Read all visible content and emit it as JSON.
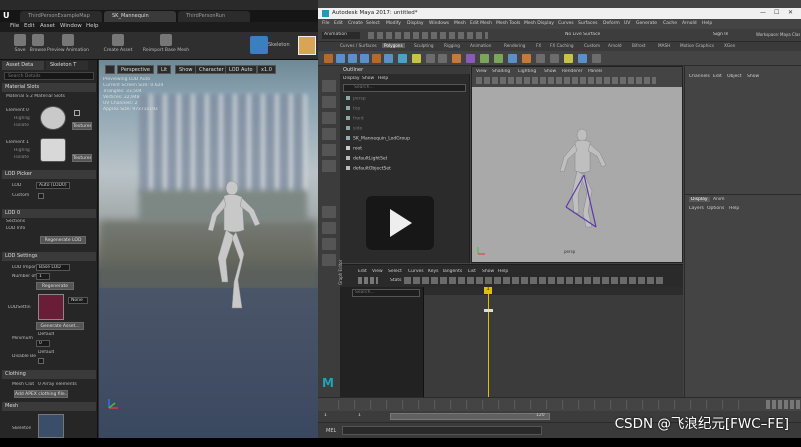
{
  "ue": {
    "tabs": [
      "ThirdPersonExampleMap",
      "SK_Mannequin",
      "ThirdPersonRun"
    ],
    "menu": [
      "File",
      "Edit",
      "Asset",
      "Window",
      "Help"
    ],
    "toolbar": [
      "Save",
      "Browse",
      "Preview Animation",
      "Create Asset",
      "Reimport Base Mesh"
    ],
    "skeleton_label": "Skeleton",
    "panel_tabs": [
      "Asset Deta",
      "Skeleton T"
    ],
    "search_placeholder": "Search Details",
    "sections": {
      "material_slots": "Material Slots",
      "lod_picker": "LOD Picker",
      "lod0": "LOD 0",
      "lod_settings": "LOD Settings",
      "clothing": "Clothing",
      "mesh": "Mesh"
    },
    "material_slots_text": "Material S  2 Material Slots",
    "element0": "Element 0",
    "element1": "Element 1",
    "highlight": "Highlig",
    "isolate": "Isolate",
    "textures": "Textures",
    "lod_label": "LOD",
    "lod_value": "Auto (LOD0)",
    "custom_label": "Custom",
    "sections_label": "Sections",
    "lod_info_label": "LOD Info",
    "regen_lod": "Regenerate LOD",
    "lod_import_label": "LOD Import",
    "lod_import_value": "Base LOD",
    "number_of_lods_label": "Number of",
    "number_of_lods_value": "1",
    "regenerate": "Regenerate",
    "lod_setting_label": "LODSettin",
    "lod_setting_value": "None",
    "generate_asset": "Generate Asset...",
    "minimum_lod_label": "Minimum",
    "default_label": "Default",
    "default_value": "0",
    "disable_below_label": "Disable Be",
    "mesh_clot_label": "Mesh Clot",
    "mesh_clot_value": "0 Array elements",
    "add_apex": "Add APEX clothing file...",
    "skeleton_row": "Skeleton",
    "viewport_buttons": [
      "Perspective",
      "Lit",
      "Show",
      "Character",
      "LOD Auto",
      "x1.0"
    ],
    "viewport_stats": [
      "Previewing LOD Auto",
      "Current Screen Size: 0.624",
      "Triangles: 33,504",
      "Vertices: 22,948",
      "UV Channels: 2",
      "Approx Size: 97x71x192"
    ]
  },
  "maya": {
    "title": "Autodesk Maya 2017: untitled*",
    "menu": [
      "File",
      "Edit",
      "Create",
      "Select",
      "Modify",
      "Display",
      "Windows",
      "Mesh",
      "Edit Mesh",
      "Mesh Tools",
      "Mesh Display",
      "Curves",
      "Surfaces",
      "Deform",
      "UV",
      "Generate",
      "Cache",
      "Arnold",
      "Help"
    ],
    "mode": "Animation",
    "live_surface": "No Live Surface",
    "workspace_label": "Workspace:",
    "workspace_value": "Maya Classic",
    "sign_in": "Sign In",
    "shelf_tabs": [
      "Curves / Surfaces",
      "Polygons",
      "Sculpting",
      "Rigging",
      "Animation",
      "Rendering",
      "FX",
      "FX Caching",
      "Custom",
      "Arnold",
      "Bifrost",
      "MASH",
      "Motion Graphics",
      "XGen"
    ],
    "outliner_title": "Outliner",
    "outliner_menu": [
      "Display",
      "Show",
      "Help"
    ],
    "outliner_search": "Search...",
    "outliner_items": [
      "persp",
      "top",
      "front",
      "side",
      "SK_Mannequin_LodGroup",
      "root",
      "defaultLightSet",
      "defaultObjectSet"
    ],
    "viewport_menu": [
      "View",
      "Shading",
      "Lighting",
      "Show",
      "Renderer",
      "Panels"
    ],
    "viewport_label": "persp",
    "channel_menu": [
      "Channels",
      "Edit",
      "Object",
      "Show"
    ],
    "display_tabs": [
      "Display",
      "Anim"
    ],
    "display_menu": [
      "Layers",
      "Options",
      "Help"
    ],
    "graph_editor_label": "Graph Editor",
    "graph_menu": [
      "Edit",
      "View",
      "Select",
      "Curves",
      "Keys",
      "Tangents",
      "List",
      "Show",
      "Help"
    ],
    "stats_label": "Stats",
    "graph_search": "Search...",
    "current_frame_marker": "1",
    "range_start": "1",
    "range_inner": "1",
    "range_end": "120",
    "cmd_label": "MEL"
  },
  "watermark": "CSDN @飞浪纪元[FWC–FE]"
}
